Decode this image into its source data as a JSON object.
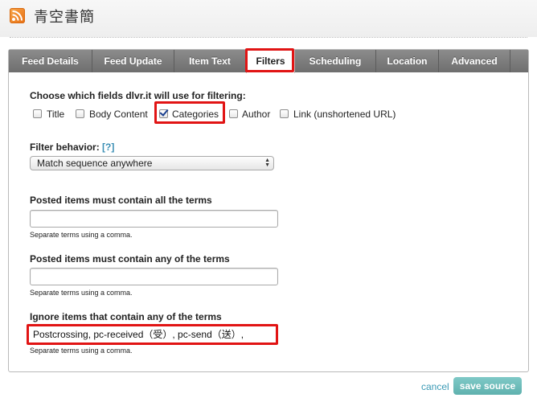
{
  "header": {
    "title": "青空書簡",
    "rss_icon": "rss-feed-icon"
  },
  "tabs": [
    {
      "label": "Feed Details"
    },
    {
      "label": "Feed Update"
    },
    {
      "label": "Item Text"
    },
    {
      "label": "Filters"
    },
    {
      "label": "Scheduling"
    },
    {
      "label": "Location"
    },
    {
      "label": "Advanced"
    }
  ],
  "filters": {
    "fields_heading": "Choose which fields dlvr.it will use for filtering:",
    "fields": [
      {
        "label": "Title",
        "checked": false
      },
      {
        "label": "Body Content",
        "checked": false
      },
      {
        "label": "Categories",
        "checked": true
      },
      {
        "label": "Author",
        "checked": false
      },
      {
        "label": "Link (unshortened URL)",
        "checked": false
      }
    ],
    "behavior_label": "Filter behavior:",
    "behavior_help": "[?]",
    "behavior_value": "Match sequence anywhere",
    "all_terms_label": "Posted items must contain all the terms",
    "all_terms_value": "",
    "any_terms_label": "Posted items must contain any of the terms",
    "any_terms_value": "",
    "ignore_label": "Ignore items that contain any of the terms",
    "ignore_value": "Postcrossing, pc-received（受）, pc-send（送）,",
    "hint": "Separate terms using a comma."
  },
  "footer": {
    "cancel_label": "cancel",
    "save_label": "save source"
  },
  "colors": {
    "highlight": "#e11414",
    "accent": "#3b9ab5",
    "save_button": "#6fbdba"
  }
}
